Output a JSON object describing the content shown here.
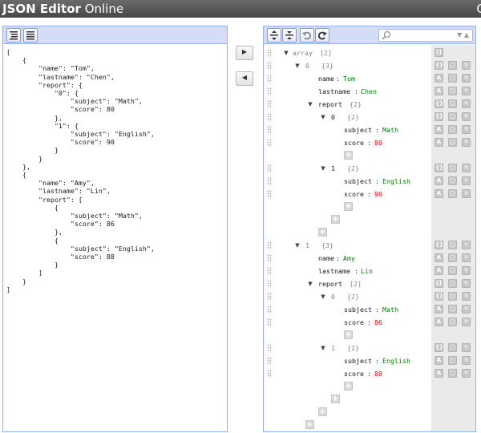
{
  "app": {
    "title_bold": "JSON Editor",
    "title_rest": " Online",
    "title_clip": "G"
  },
  "code_text": "[\n    {\n        \"name\": \"Tom\",\n        \"lastname\": \"Chen\",\n        \"report\": {\n            \"0\": {\n                \"subject\": \"Math\",\n                \"score\": 80\n            },\n            \"1\": {\n                \"subject\": \"English\",\n                \"score\": 90\n            }\n        }\n    },\n    {\n        \"name\": \"Amy\",\n        \"lastname\": \"Lin\",\n        \"report\": [\n            {\n                \"subject\": \"Math\",\n                \"score\": 86\n            },\n            {\n                \"subject\": \"English\",\n                \"score\": 88\n            }\n        ]\n    }\n]",
  "split": {
    "to_tree_glyph": "▶",
    "to_code_glyph": "◀"
  },
  "search": {
    "placeholder": "",
    "carets": "▼ ▲"
  },
  "toggle": {
    "open": "▼"
  },
  "icons": {
    "add": "+",
    "type_auto": "A"
  },
  "tree": {
    "root": {
      "key": "array",
      "count": "[2]"
    },
    "item0": {
      "index": "0",
      "count": "{3}"
    },
    "item0_name": {
      "key": "name",
      "value": "Tom"
    },
    "item0_lastname": {
      "key": "lastname",
      "value": "Chen"
    },
    "item0_report": {
      "key": "report",
      "count": "{2}"
    },
    "item0_r0": {
      "index": "0",
      "count": "{2}"
    },
    "item0_r0_subject": {
      "key": "subject",
      "value": "Math"
    },
    "item0_r0_score": {
      "key": "score",
      "value": "80"
    },
    "item0_r1": {
      "index": "1",
      "count": "{2}"
    },
    "item0_r1_subject": {
      "key": "subject",
      "value": "English"
    },
    "item0_r1_score": {
      "key": "score",
      "value": "90"
    },
    "item1": {
      "index": "1",
      "count": "{3}"
    },
    "item1_name": {
      "key": "name",
      "value": "Amy"
    },
    "item1_lastname": {
      "key": "lastname",
      "value": "Lin"
    },
    "item1_report": {
      "key": "report",
      "count": "[2]"
    },
    "item1_r0": {
      "index": "0",
      "count": "{2}"
    },
    "item1_r0_subject": {
      "key": "subject",
      "value": "Math"
    },
    "item1_r0_score": {
      "key": "score",
      "value": "86"
    },
    "item1_r1": {
      "index": "1",
      "count": "{2}"
    },
    "item1_r1_subject": {
      "key": "subject",
      "value": "English"
    },
    "item1_r1_score": {
      "key": "score",
      "value": "88"
    },
    "separator": ":"
  },
  "colors": {
    "string_value": "#008000",
    "number_value": "#ee0000",
    "panel_border": "#97b0f8",
    "menu_bg": "#d5ddf6"
  }
}
